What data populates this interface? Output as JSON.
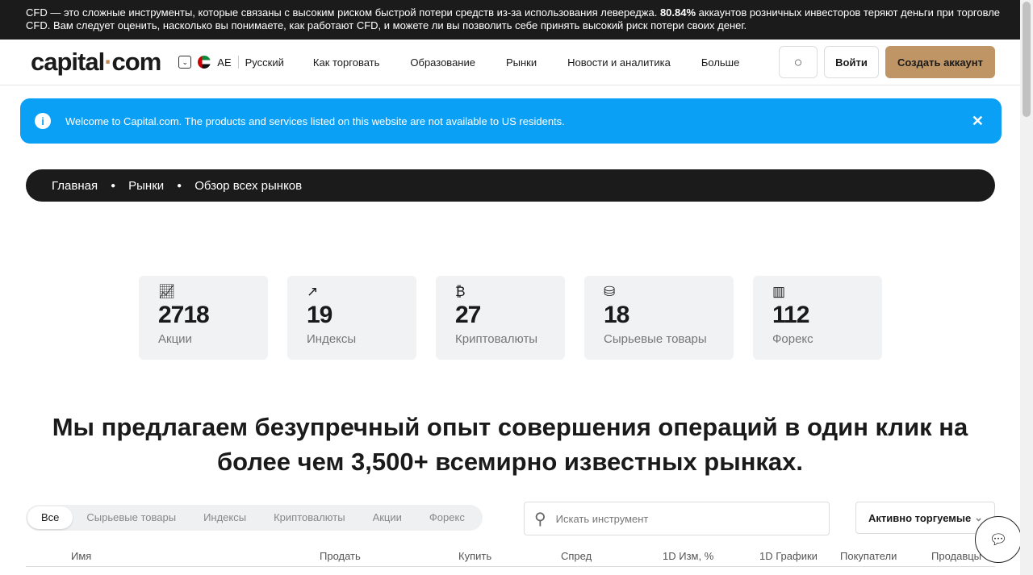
{
  "risk_banner": {
    "text_before": "CFD — это сложные инструменты, которые связаны с высоким риском быстрой потери средств из-за использования левереджа. ",
    "percent": "80.84%",
    "text_after": " аккаунтов розничных инвесторов теряют деньги при торговле CFD. Вам следует оценить, насколько вы понимаете, как работают CFD, и можете ли вы позволить себе принять высокий риск потери своих денег."
  },
  "header": {
    "logo_left": "capital",
    "logo_dot": "·",
    "logo_right": "com",
    "region": "AE",
    "language": "Русский",
    "menu": [
      "Как торговать",
      "Образование",
      "Рынки",
      "Новости и аналитика",
      "Больше"
    ],
    "login": "Войти",
    "signup": "Создать аккаунт"
  },
  "alert": {
    "text": "Welcome to Capital.com. The products and services listed on this website are not available to US residents."
  },
  "breadcrumb": [
    "Главная",
    "Рынки",
    "Обзор всех рынков"
  ],
  "stats": [
    {
      "icon": "chart-line-icon",
      "count": "2718",
      "label": "Акции"
    },
    {
      "icon": "trending-up-icon",
      "count": "19",
      "label": "Индексы"
    },
    {
      "icon": "bitcoin-icon",
      "count": "27",
      "label": "Криптовалюты"
    },
    {
      "icon": "coins-icon",
      "count": "18",
      "label": "Сырьевые товары"
    },
    {
      "icon": "bar-chart-icon",
      "count": "112",
      "label": "Форекс"
    }
  ],
  "headline": "Мы предлагаем безупречный опыт совершения операций в один клик на более чем 3,500+ всемирно известных рынках.",
  "filters": {
    "tabs": [
      "Все",
      "Сырьевые товары",
      "Индексы",
      "Криптовалюты",
      "Акции",
      "Форекс"
    ],
    "active": "Все",
    "search_placeholder": "Искать инструмент",
    "sort": "Активно торгуемые"
  },
  "table": {
    "columns": [
      "Имя",
      "Продать",
      "Купить",
      "Спред",
      "1D Изм, %",
      "1D Графики",
      "Покупатели",
      "Продавцы"
    ]
  },
  "colors": {
    "accent": "#c09565",
    "alert": "#0aa0f5",
    "dark": "#1b1b1b"
  }
}
